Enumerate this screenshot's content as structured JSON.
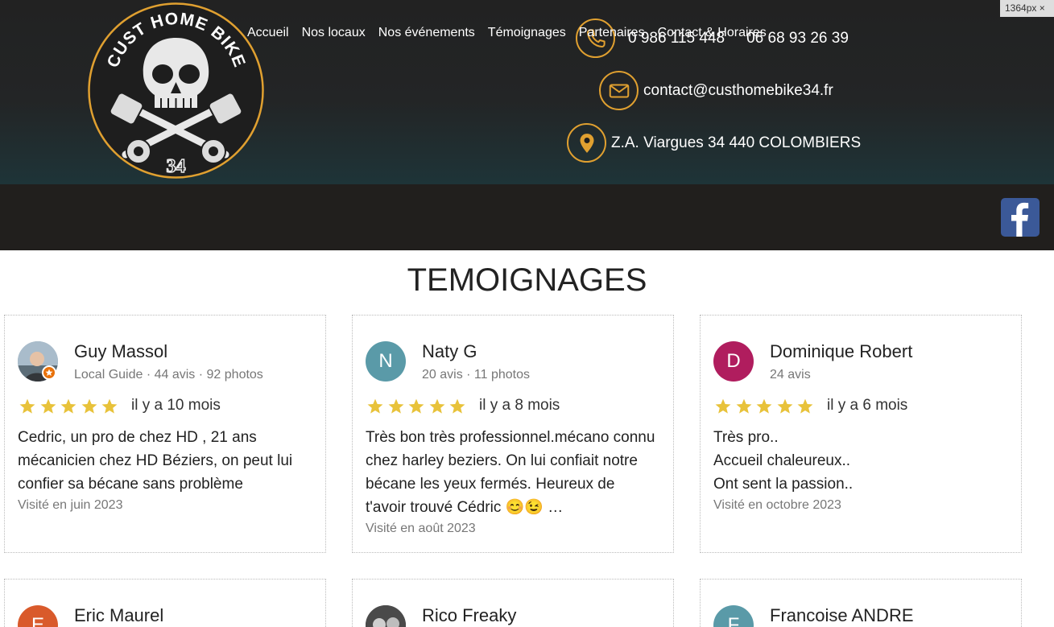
{
  "header": {
    "phone_1": "0 986 115 448",
    "phone_2": "06 68 93 26 39",
    "email": "contact@custhomebike34.fr",
    "address": "Z.A. Viargues  34 440 COLOMBIERS",
    "accent_color": "#e0a030",
    "icons": [
      "phone-icon",
      "mail-icon",
      "location-pin-icon"
    ]
  },
  "logo": {
    "top_text": "CUST HOME BIKE",
    "number": "34"
  },
  "nav": {
    "items": [
      "Accueil",
      "Nos locaux",
      "Nos événements",
      "Témoignages",
      "Partenaires",
      "Contact & Horaires"
    ],
    "facebook_icon": "facebook-icon"
  },
  "viewport_badge": "1364px ×",
  "page_title": "TEMOIGNAGES",
  "reviews": [
    {
      "name": "Guy Massol",
      "meta": "Local Guide · 44 avis · 92 photos",
      "rating": 5,
      "when": "il y a 10 mois",
      "text": [
        "Cedric, un pro de chez HD , 21 ans",
        "mécanicien chez HD Béziers, on peut lui",
        "confier sa bécane sans problème"
      ],
      "visited": "Visité en juin 2023",
      "avatar": "photo"
    },
    {
      "name": "Naty G",
      "meta": "20 avis · 11 photos",
      "rating": 5,
      "when": "il y a 8 mois",
      "text": [
        "Très bon très professionnel.mécano connu",
        "chez harley beziers. On lui confiait notre",
        "bécane les yeux fermés. Heureux de",
        "t'avoir trouvé Cédric 😊😉 …"
      ],
      "visited": "Visité en août 2023",
      "avatar": "N",
      "avatar_color": "#5a9aa8"
    },
    {
      "name": "Dominique Robert",
      "meta": "24 avis",
      "rating": 5,
      "when": "il y a 6 mois",
      "text": [
        "Très pro..",
        "Accueil chaleureux..",
        "Ont sent la passion.."
      ],
      "visited": "Visité en octobre 2023",
      "avatar": "D",
      "avatar_color": "#b01d5e"
    },
    {
      "name": "Eric Maurel",
      "avatar": "E",
      "avatar_color": "#d95a2b"
    },
    {
      "name": "Rico Freaky",
      "avatar": "photo"
    },
    {
      "name": "Francoise ANDRE",
      "avatar": "F",
      "avatar_color": "#5a9aa8"
    }
  ],
  "star_color": "#e8c23a"
}
